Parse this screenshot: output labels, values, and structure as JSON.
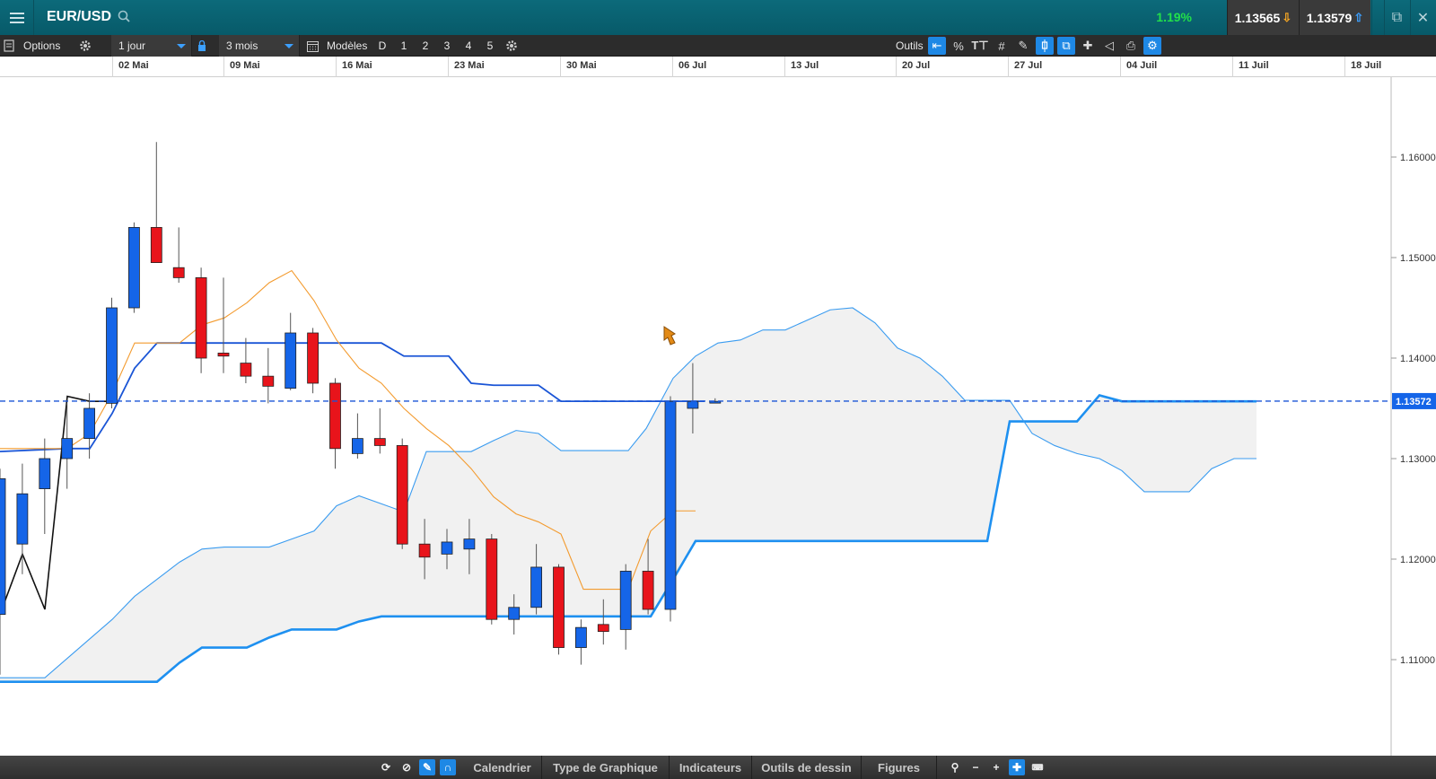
{
  "header": {
    "symbol": "EUR/USD",
    "change_pct": "1.19%",
    "bid": "1.13565",
    "ask": "1.13579",
    "bid_arrow_color": "#f5a623",
    "ask_arrow_color": "#3ca0ff"
  },
  "toolbar": {
    "options_label": "Options",
    "interval": "1 jour",
    "range": "3 mois",
    "models_label": "Modèles",
    "presets": [
      "D",
      "1",
      "2",
      "3",
      "4",
      "5"
    ],
    "tools_label": "Outils",
    "tool_icons": [
      "back-arrow-icon",
      "percent-icon",
      "text-size-icon",
      "grid-icon",
      "line-style-icon",
      "candle-icon",
      "windows-icon",
      "crosshair-icon",
      "tag-icon",
      "print-icon",
      "settings-pointer-icon"
    ]
  },
  "time_axis": {
    "ticks": [
      "02 Mai",
      "09 Mai",
      "16 Mai",
      "23 Mai",
      "30 Mai",
      "06 Jul",
      "13 Jul",
      "20 Jul",
      "27 Jul",
      "04 Juil",
      "11 Juil",
      "18 Juil"
    ]
  },
  "chart_data": {
    "type": "candlestick",
    "instrument": "EUR/USD",
    "price_axis": {
      "ticks": [
        "1.16000",
        "1.15000",
        "1.14000",
        "1.13000",
        "1.12000",
        "1.11000"
      ],
      "tick_values": [
        1.16,
        1.15,
        1.14,
        1.13,
        1.12,
        1.11
      ],
      "ylim": [
        1.1035,
        1.167
      ]
    },
    "current_price": {
      "value": 1.13572,
      "label": "1.13572"
    },
    "candles": [
      {
        "o": 1.1145,
        "h": 1.129,
        "l": 1.1085,
        "c": 1.128
      },
      {
        "o": 1.1215,
        "h": 1.1295,
        "l": 1.1185,
        "c": 1.1265
      },
      {
        "o": 1.127,
        "h": 1.132,
        "l": 1.1225,
        "c": 1.13
      },
      {
        "o": 1.13,
        "h": 1.1355,
        "l": 1.127,
        "c": 1.132
      },
      {
        "o": 1.132,
        "h": 1.1365,
        "l": 1.13,
        "c": 1.135
      },
      {
        "o": 1.1355,
        "h": 1.146,
        "l": 1.135,
        "c": 1.145
      },
      {
        "o": 1.145,
        "h": 1.1535,
        "l": 1.1445,
        "c": 1.153
      },
      {
        "o": 1.153,
        "h": 1.1615,
        "l": 1.1495,
        "c": 1.1495
      },
      {
        "o": 1.149,
        "h": 1.153,
        "l": 1.1475,
        "c": 1.148
      },
      {
        "o": 1.148,
        "h": 1.149,
        "l": 1.1385,
        "c": 1.14
      },
      {
        "o": 1.1405,
        "h": 1.148,
        "l": 1.1385,
        "c": 1.1402
      },
      {
        "o": 1.1395,
        "h": 1.142,
        "l": 1.1375,
        "c": 1.1382
      },
      {
        "o": 1.1382,
        "h": 1.141,
        "l": 1.1355,
        "c": 1.1372
      },
      {
        "o": 1.137,
        "h": 1.1445,
        "l": 1.1368,
        "c": 1.1425
      },
      {
        "o": 1.1425,
        "h": 1.143,
        "l": 1.1365,
        "c": 1.1375
      },
      {
        "o": 1.1375,
        "h": 1.138,
        "l": 1.129,
        "c": 1.131
      },
      {
        "o": 1.1305,
        "h": 1.1345,
        "l": 1.13,
        "c": 1.132
      },
      {
        "o": 1.132,
        "h": 1.135,
        "l": 1.1305,
        "c": 1.1313
      },
      {
        "o": 1.1313,
        "h": 1.132,
        "l": 1.121,
        "c": 1.1215
      },
      {
        "o": 1.1215,
        "h": 1.124,
        "l": 1.118,
        "c": 1.1202
      },
      {
        "o": 1.1205,
        "h": 1.123,
        "l": 1.119,
        "c": 1.1217
      },
      {
        "o": 1.121,
        "h": 1.124,
        "l": 1.1185,
        "c": 1.122
      },
      {
        "o": 1.122,
        "h": 1.1225,
        "l": 1.1135,
        "c": 1.114
      },
      {
        "o": 1.114,
        "h": 1.1165,
        "l": 1.1125,
        "c": 1.1152
      },
      {
        "o": 1.1152,
        "h": 1.1215,
        "l": 1.1145,
        "c": 1.1192
      },
      {
        "o": 1.1192,
        "h": 1.1195,
        "l": 1.1105,
        "c": 1.1112
      },
      {
        "o": 1.1112,
        "h": 1.114,
        "l": 1.1095,
        "c": 1.1132
      },
      {
        "o": 1.1135,
        "h": 1.116,
        "l": 1.1115,
        "c": 1.1128
      },
      {
        "o": 1.113,
        "h": 1.1195,
        "l": 1.111,
        "c": 1.1188
      },
      {
        "o": 1.1188,
        "h": 1.122,
        "l": 1.1145,
        "c": 1.115
      },
      {
        "o": 1.115,
        "h": 1.1362,
        "l": 1.1138,
        "c": 1.1357
      },
      {
        "o": 1.135,
        "h": 1.1395,
        "l": 1.1325,
        "c": 1.1357
      },
      {
        "o": 1.1357,
        "h": 1.136,
        "l": 1.1355,
        "c": 1.1357
      }
    ],
    "colors": {
      "up": "#1565e8",
      "down": "#e8141b",
      "tenkan": "#f39b2f",
      "kijun": "#1a55d6",
      "span_a": "#3b9cf0",
      "span_b": "#1e90f0",
      "chikou": "#111111",
      "cloud": "#eeeeee"
    }
  },
  "bottombar": {
    "icons": [
      "refresh-icon",
      "clear-icon",
      "pencil-icon",
      "magnet-icon"
    ],
    "tabs": [
      "Calendrier",
      "Type de Graphique",
      "Indicateurs",
      "Outils de dessin",
      "Figures"
    ],
    "right_icons": [
      "zoom-icon",
      "zoom-out-icon",
      "zoom-in-icon",
      "crosshair-icon",
      "keyboard-icon"
    ]
  }
}
